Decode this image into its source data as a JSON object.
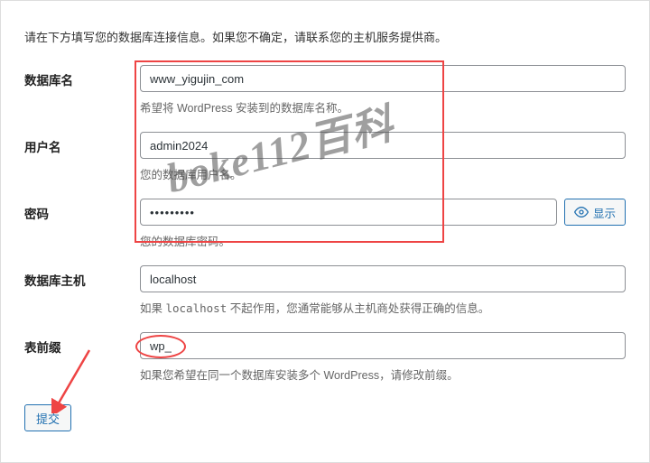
{
  "intro": "请在下方填写您的数据库连接信息。如果您不确定，请联系您的主机服务提供商。",
  "fields": {
    "dbname": {
      "label": "数据库名",
      "value": "www_yigujin_com",
      "help": "希望将 WordPress 安装到的数据库名称。"
    },
    "username": {
      "label": "用户名",
      "value": "admin2024",
      "help": "您的数据库用户名。"
    },
    "password": {
      "label": "密码",
      "value": "•••••••••",
      "help": "您的数据库密码。",
      "show_label": "显示"
    },
    "dbhost": {
      "label": "数据库主机",
      "value": "localhost",
      "help_pre": "如果 ",
      "help_code": "localhost",
      "help_post": " 不起作用，您通常能够从主机商处获得正确的信息。"
    },
    "prefix": {
      "label": "表前缀",
      "value": "wp_",
      "help": "如果您希望在同一个数据库安装多个 WordPress，请修改前缀。"
    }
  },
  "submit_label": "提交",
  "watermark": "boke112百科"
}
